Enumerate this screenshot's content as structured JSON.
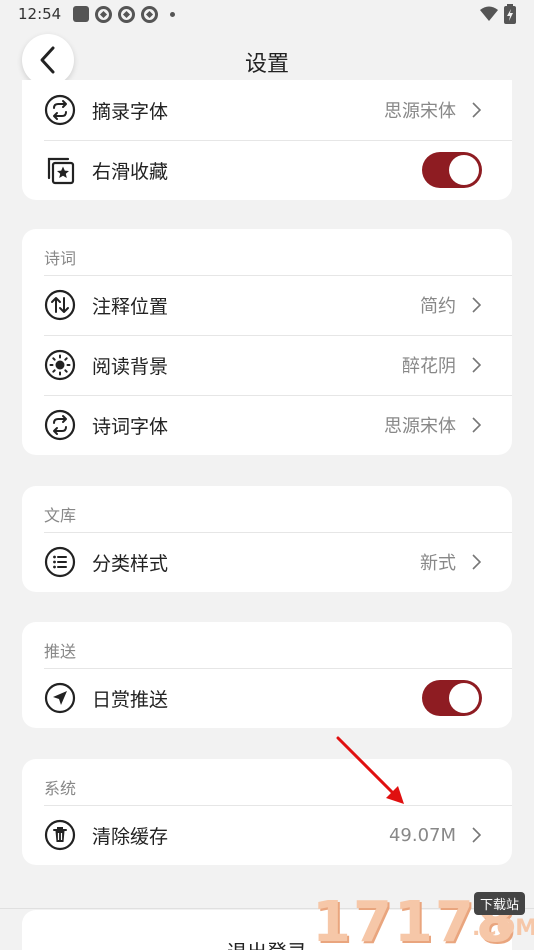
{
  "status_bar": {
    "time": "12:54",
    "icons": [
      "square-icon",
      "pinwheel-icon",
      "pinwheel-icon",
      "pinwheel-icon",
      "dot-icon"
    ],
    "right_icons": [
      "wifi-icon",
      "battery-icon"
    ]
  },
  "header": {
    "title": "设置",
    "back_icon": "chevron-left-icon"
  },
  "top_section": {
    "rows": [
      {
        "icon": "swap-icon",
        "label": "摘录字体",
        "value": "思源宋体"
      },
      {
        "icon": "star-stack-icon",
        "label": "右滑收藏",
        "toggle": true
      }
    ]
  },
  "poetry_section": {
    "title": "诗词",
    "rows": [
      {
        "icon": "sort-arrows-icon",
        "label": "注释位置",
        "value": "简约"
      },
      {
        "icon": "sun-icon",
        "label": "阅读背景",
        "value": "醉花阴"
      },
      {
        "icon": "swap-icon",
        "label": "诗词字体",
        "value": "思源宋体"
      }
    ]
  },
  "library_section": {
    "title": "文库",
    "rows": [
      {
        "icon": "list-icon",
        "label": "分类样式",
        "value": "新式"
      }
    ]
  },
  "push_section": {
    "title": "推送",
    "rows": [
      {
        "icon": "send-icon",
        "label": "日赏推送",
        "toggle": true
      }
    ]
  },
  "system_section": {
    "title": "系统",
    "rows": [
      {
        "icon": "trash-icon",
        "label": "清除缓存",
        "value": "49.07M"
      }
    ]
  },
  "logout": {
    "label": "退出登录"
  },
  "watermark": {
    "number": "17178",
    "badge": "下载站",
    "domain": ".COM"
  },
  "colors": {
    "accent": "#8e1c22",
    "background": "#f2f2f2",
    "card": "#ffffff",
    "annotation": "#e01010"
  }
}
